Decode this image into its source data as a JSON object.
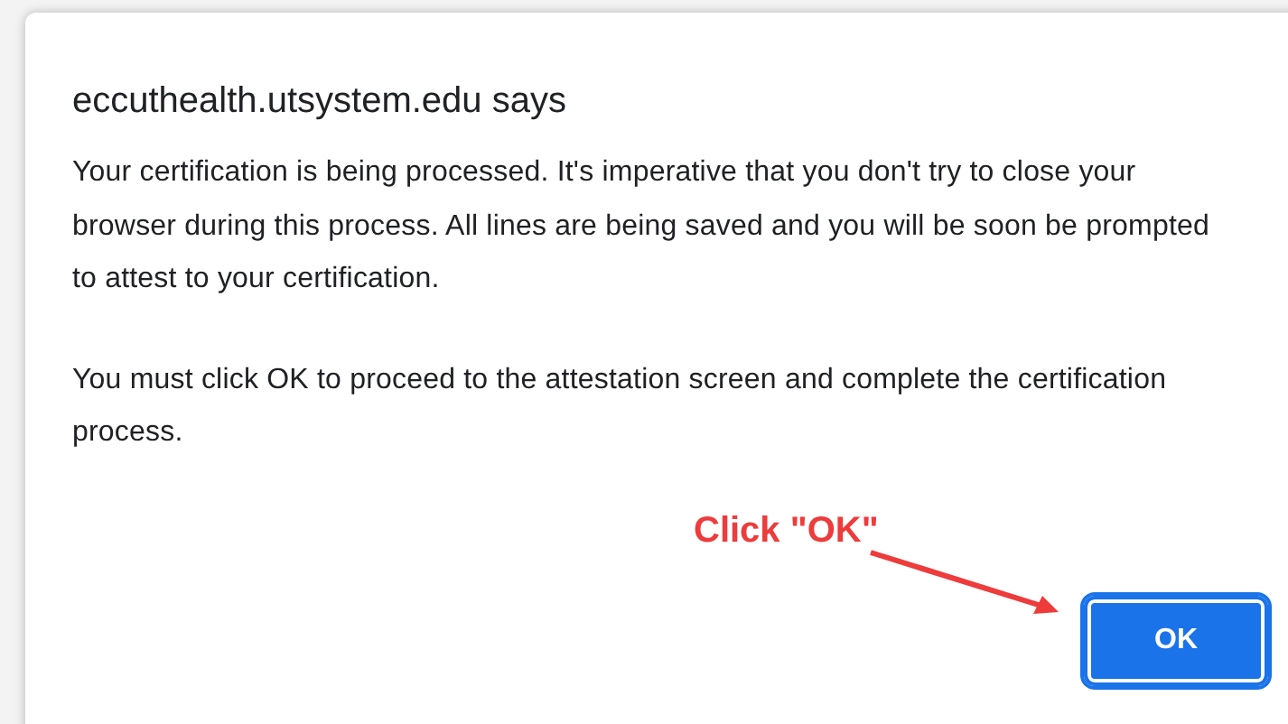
{
  "dialog": {
    "title": "eccuthealth.utsystem.edu says",
    "paragraphs": [
      "Your certification is being processed. It's imperative that you don't try to close your browser during this process. All lines are being saved and you will be soon be prompted to attest to your certification.",
      "You must click OK to proceed to the attestation screen and complete the certification process."
    ],
    "buttons": [
      {
        "label": "OK",
        "focused": true
      }
    ]
  },
  "annotation": {
    "text": "Click \"OK\""
  }
}
